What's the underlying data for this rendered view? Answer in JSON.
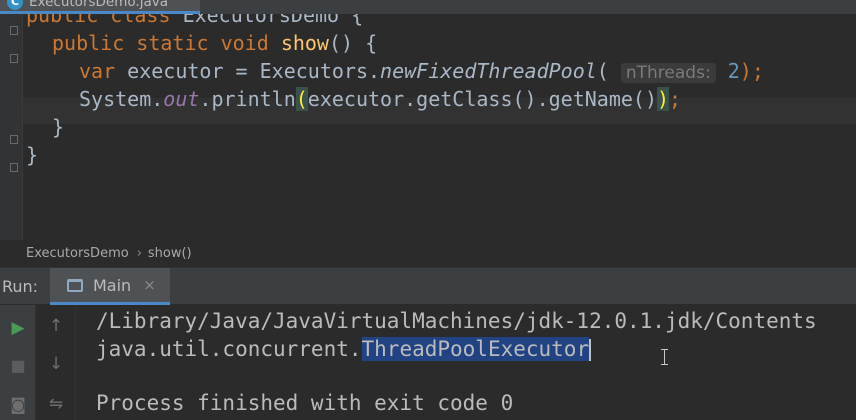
{
  "editor_tab": {
    "icon_letter": "C",
    "label": "ExecutorsDemo.java"
  },
  "code": {
    "line1": {
      "public": "public",
      "class": "class",
      "name": "ExecutorsDemo",
      "brace": " {"
    },
    "line2": {
      "public": "public",
      "static": "static",
      "void": "void",
      "method": "show",
      "rest": "() {"
    },
    "line3": {
      "var": "var",
      "assign": " executor = Executors.",
      "call": "newFixedThreadPool",
      "paren": "(",
      "hint": "nThreads:",
      "arg": "2",
      "end": ");"
    },
    "line4": {
      "system": "System.",
      "out": "out",
      "println": ".println",
      "open_paren": "(",
      "args": "executor.getClass().getName()",
      "close_paren": ")",
      "end": ";"
    },
    "line5": "}",
    "line6": "}"
  },
  "breadcrumb": {
    "class_name": "ExecutorsDemo",
    "separator": "›",
    "method": "show()"
  },
  "run_panel": {
    "label": "Run:",
    "tab_label": "Main",
    "tab_close": "×"
  },
  "console": {
    "line1": "/Library/Java/JavaVirtualMachines/jdk-12.0.1.jdk/Contents",
    "line2_prefix": "java.util.concurrent.",
    "line2_selected": "ThreadPoolExecutor",
    "line3": "",
    "line4": "Process finished with exit code 0"
  },
  "icons": {
    "run": "▶",
    "stop": "■",
    "camera": "◙",
    "up_arrow": "↑",
    "down_arrow": "↓",
    "wrap": "⇋"
  },
  "colors": {
    "run_green": "#499c54",
    "selection": "#214283",
    "keyword": "#cc7832",
    "method_decl": "#ffc66d",
    "number": "#6897bb"
  }
}
